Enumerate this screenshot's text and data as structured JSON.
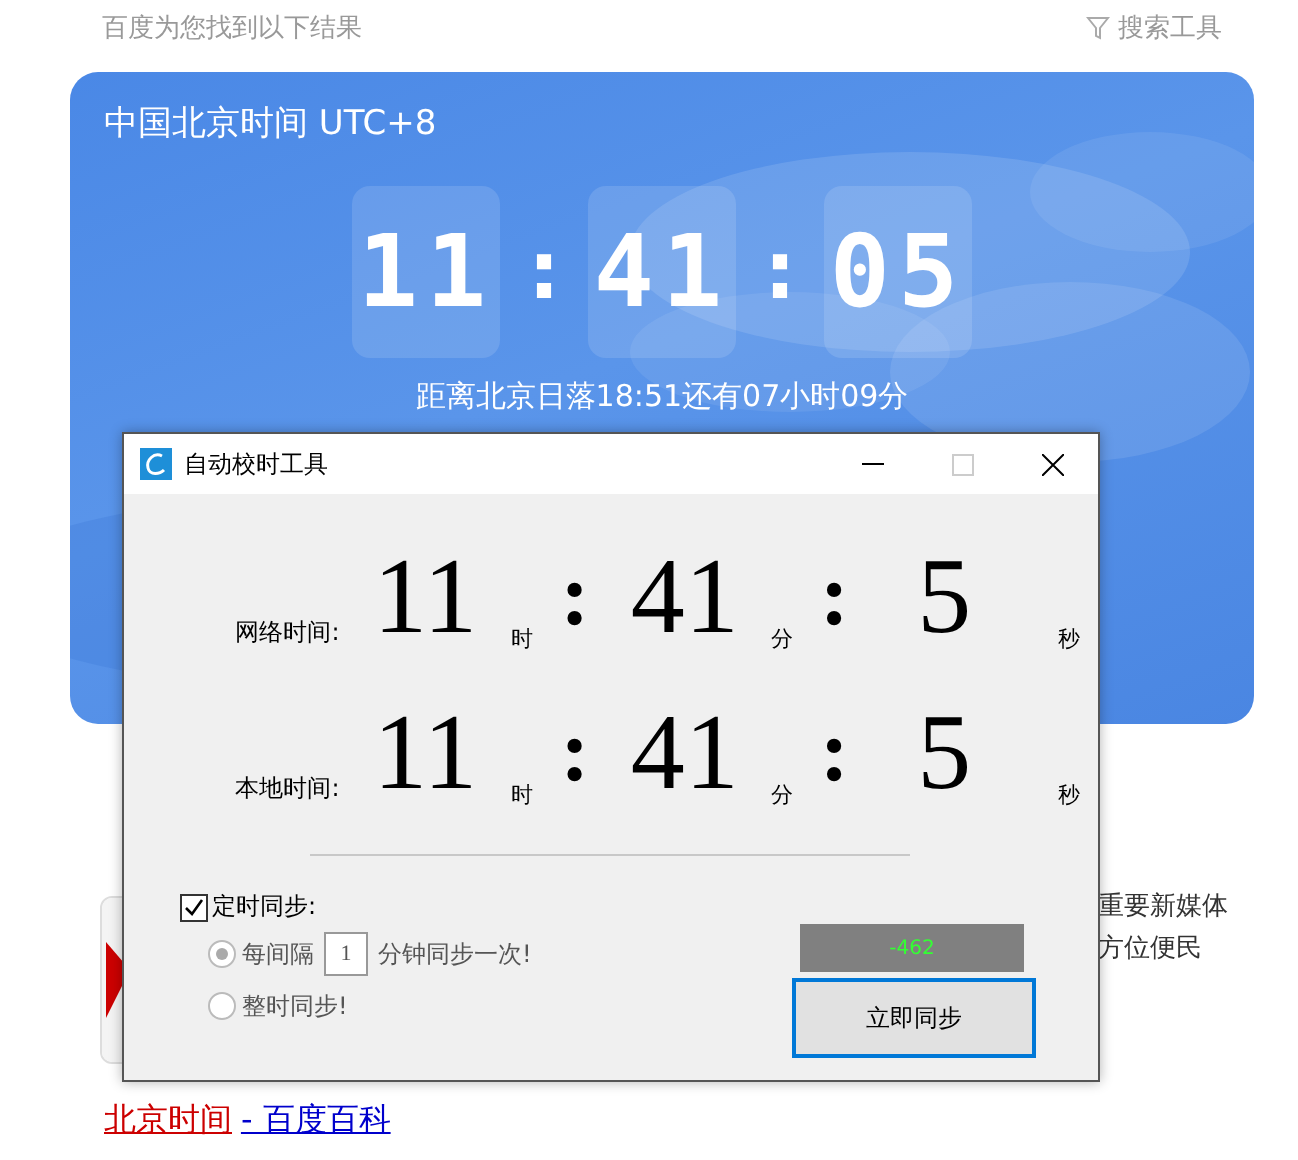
{
  "page": {
    "result_note": "百度为您找到以下结果",
    "search_tools": "搜索工具"
  },
  "clock_card": {
    "title": "中国北京时间 UTC+8",
    "separator": ":",
    "digits": [
      "11",
      "41",
      "05"
    ],
    "sunset_note": "距离北京日落18:51还有07小时09分"
  },
  "background_results": {
    "snippet_lines": [
      "重要新媒体",
      "方位便民"
    ],
    "bottom_link": {
      "title": "北京时间",
      "source": "- 百度百科"
    }
  },
  "dialog": {
    "title": "自动校时工具",
    "separator": ":",
    "rows": [
      {
        "label": "网络时间:",
        "hour": "11",
        "hour_unit": "时",
        "minute": "41",
        "minute_unit": "分",
        "second": "5",
        "second_unit": "秒"
      },
      {
        "label": "本地时间:",
        "hour": "11",
        "hour_unit": "时",
        "minute": "41",
        "minute_unit": "分",
        "second": "5",
        "second_unit": "秒"
      }
    ],
    "timed_sync": {
      "label": "定时同步:",
      "checked": true
    },
    "options": [
      {
        "kind": "interval",
        "before": "每间隔",
        "value": "1",
        "after": "分钟同步一次!",
        "selected": true,
        "disabled": true
      },
      {
        "kind": "plain",
        "label": "整时同步!",
        "selected": false,
        "disabled": true
      }
    ],
    "offset_reading": "-462",
    "sync_button": "立即同步"
  }
}
